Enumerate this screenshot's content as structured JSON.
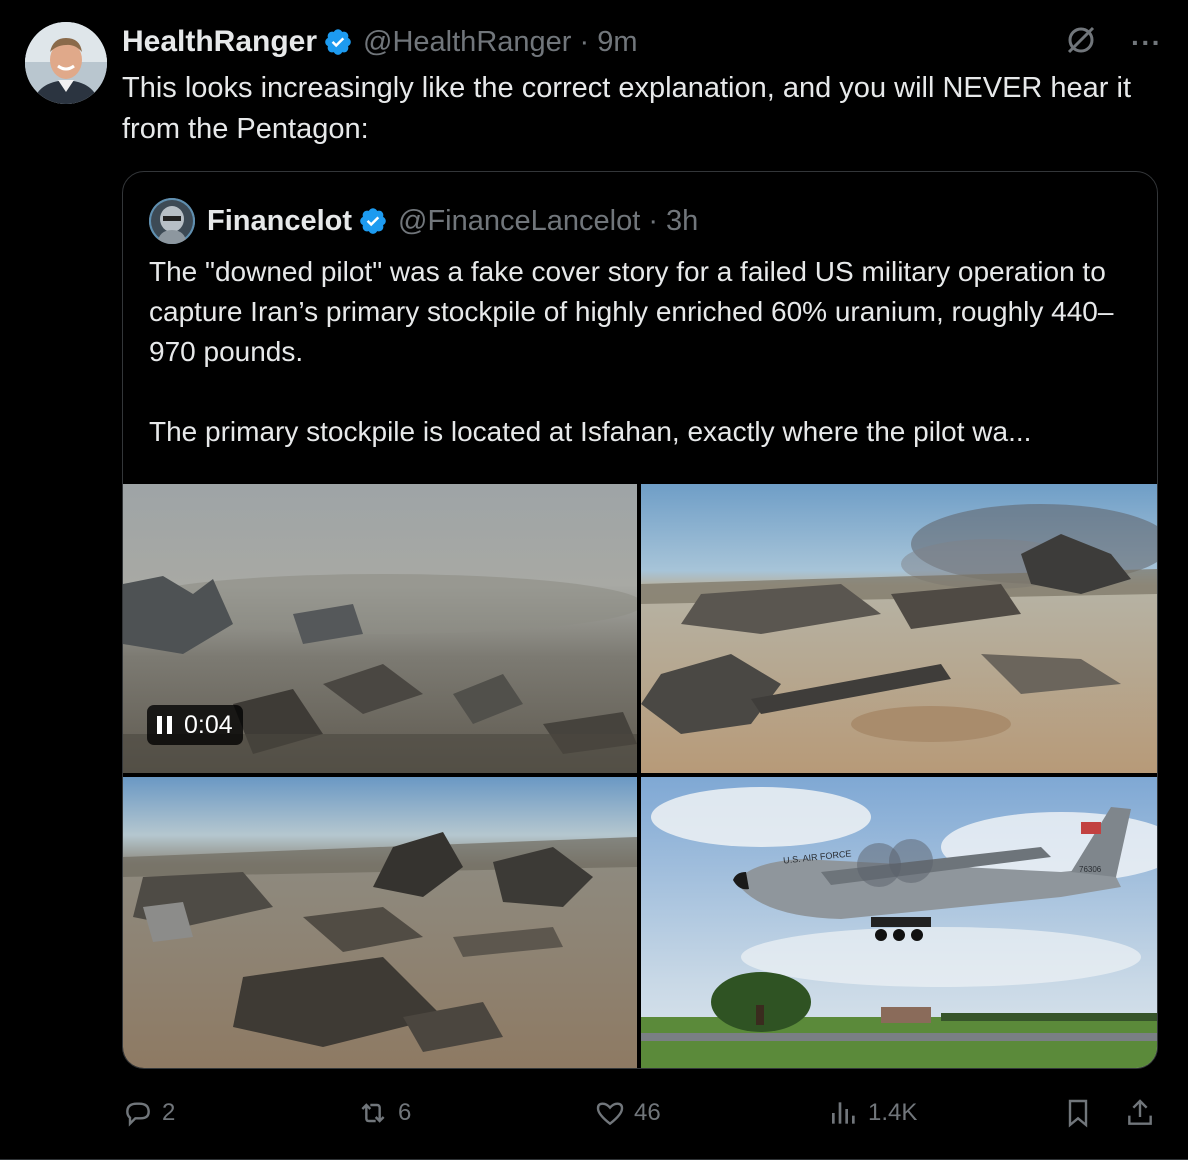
{
  "tweet": {
    "author_name": "HealthRanger",
    "handle_time": "@HealthRanger · 9m",
    "text": "This looks increasingly like the correct explanation, and you will NEVER hear it from the Pentagon:"
  },
  "icons": {
    "verified": "verified-badge-icon",
    "grok": "grok-icon",
    "more": "more-icon"
  },
  "more_label": "···",
  "quoted": {
    "author_name": "Financelot",
    "handle_time": "@FinanceLancelot · 3h",
    "text": "The \"downed pilot\" was a fake cover story for a failed US military operation to capture Iran’s primary stockpile of highly enriched 60% uranium, roughly 440–970 pounds.\n\nThe primary stockpile is located at Isfahan, exactly where the pilot wa...",
    "video_time": "0:04",
    "media": [
      "video-wreckage-field",
      "photo-wreckage-burning",
      "photo-wreckage-debris",
      "photo-c130-aircraft"
    ],
    "aircraft_text": "U.S. AIR FORCE",
    "aircraft_tail": "76306"
  },
  "actions": {
    "replies": "2",
    "reposts": "6",
    "likes": "46",
    "views": "1.4K"
  },
  "colors": {
    "background": "#000000",
    "text": "#e7e9ea",
    "muted": "#71767b",
    "verified": "#1d9bf0",
    "border": "#333639"
  }
}
